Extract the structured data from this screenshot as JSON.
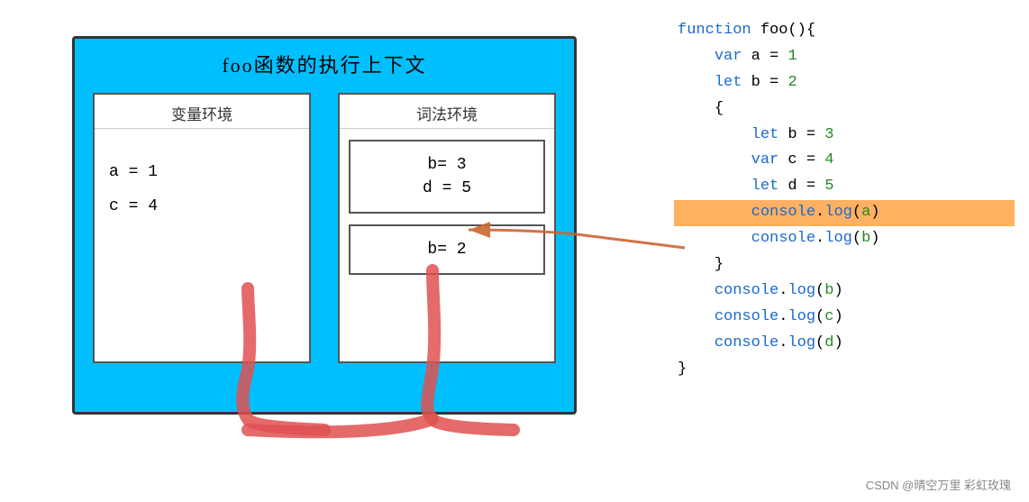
{
  "diagram": {
    "outerTitle": "foo函数的执行上下文",
    "leftPanel": {
      "title": "变量环境",
      "vars": [
        "a = 1",
        "c = 4"
      ]
    },
    "rightPanel": {
      "title": "词法环境",
      "subBoxes": [
        {
          "vars": [
            "b= 3",
            "d = 5"
          ]
        },
        {
          "vars": [
            "b= 2"
          ]
        }
      ]
    }
  },
  "code": {
    "lines": [
      {
        "text": "function foo(){",
        "highlight": false
      },
      {
        "text": "    var a = 1",
        "highlight": false
      },
      {
        "text": "    let b = 2",
        "highlight": false
      },
      {
        "text": "    {",
        "highlight": false
      },
      {
        "text": "        let b = 3",
        "highlight": false
      },
      {
        "text": "        var c = 4",
        "highlight": false
      },
      {
        "text": "        let d = 5",
        "highlight": false
      },
      {
        "text": "        console.log(a)",
        "highlight": true
      },
      {
        "text": "        console.log(b)",
        "highlight": false
      },
      {
        "text": "    }",
        "highlight": false
      },
      {
        "text": "    console.log(b)",
        "highlight": false
      },
      {
        "text": "    console.log(c)",
        "highlight": false
      },
      {
        "text": "    console.log(d)",
        "highlight": false
      },
      {
        "text": "}",
        "highlight": false
      }
    ]
  },
  "watermark": "CSDN @晴空万里 彩虹玫瑰"
}
